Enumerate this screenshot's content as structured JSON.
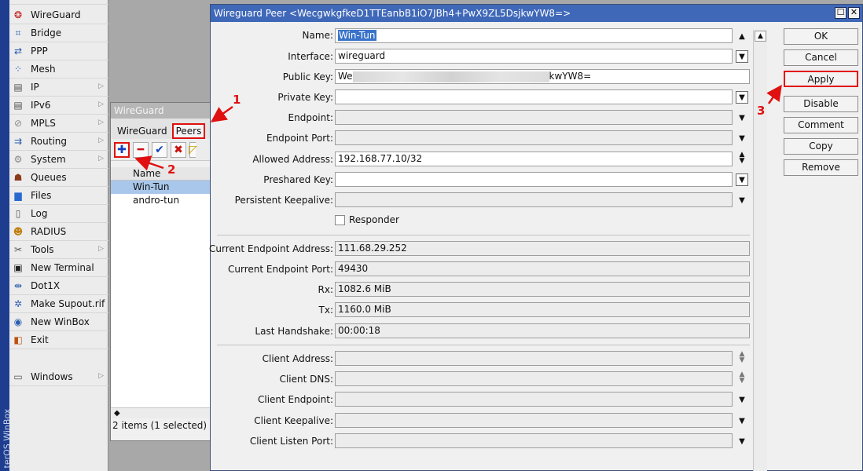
{
  "side_strip": {
    "text": "terOS WinBox"
  },
  "menu": {
    "items": [
      {
        "label": "WireGuard",
        "icon": "wireguard-icon",
        "arrow": false
      },
      {
        "label": "Bridge",
        "icon": "bridge-icon",
        "arrow": false
      },
      {
        "label": "PPP",
        "icon": "ppp-icon",
        "arrow": false
      },
      {
        "label": "Mesh",
        "icon": "mesh-icon",
        "arrow": false
      },
      {
        "label": "IP",
        "icon": "ip-icon",
        "arrow": true
      },
      {
        "label": "IPv6",
        "icon": "ipv6-icon",
        "arrow": true
      },
      {
        "label": "MPLS",
        "icon": "mpls-icon",
        "arrow": true
      },
      {
        "label": "Routing",
        "icon": "routing-icon",
        "arrow": true
      },
      {
        "label": "System",
        "icon": "system-icon",
        "arrow": true
      },
      {
        "label": "Queues",
        "icon": "queues-icon",
        "arrow": false
      },
      {
        "label": "Files",
        "icon": "files-icon",
        "arrow": false
      },
      {
        "label": "Log",
        "icon": "log-icon",
        "arrow": false
      },
      {
        "label": "RADIUS",
        "icon": "radius-icon",
        "arrow": false
      },
      {
        "label": "Tools",
        "icon": "tools-icon",
        "arrow": true
      },
      {
        "label": "New Terminal",
        "icon": "terminal-icon",
        "arrow": false
      },
      {
        "label": "Dot1X",
        "icon": "dot1x-icon",
        "arrow": false
      },
      {
        "label": "Make Supout.rif",
        "icon": "supout-icon",
        "arrow": false
      },
      {
        "label": "New WinBox",
        "icon": "winbox-icon",
        "arrow": false
      },
      {
        "label": "Exit",
        "icon": "exit-icon",
        "arrow": false
      },
      {
        "label": "Windows",
        "icon": "windows-icon",
        "arrow": true
      }
    ]
  },
  "wg_window": {
    "title": "WireGuard",
    "tabs": [
      "WireGuard",
      "Peers"
    ],
    "list_header": "Name",
    "rows": [
      {
        "name": "Win-Tun",
        "selected": true
      },
      {
        "name": "andro-tun",
        "selected": false
      }
    ],
    "status": "2 items (1 selected)"
  },
  "peer_dialog": {
    "title": "Wireguard Peer <WecgwkgfkeD1TTEanbB1iO7JBh4+PwX9ZL5DsjkwYW8=>",
    "fields": {
      "name": {
        "label": "Name:",
        "value": "Win-Tun"
      },
      "interface": {
        "label": "Interface:",
        "value": "wireguard"
      },
      "public_key": {
        "label": "Public Key:",
        "value_start": "We",
        "value_end": "kwYW8="
      },
      "private_key": {
        "label": "Private Key:",
        "value": ""
      },
      "endpoint": {
        "label": "Endpoint:",
        "value": ""
      },
      "endpoint_port": {
        "label": "Endpoint Port:",
        "value": ""
      },
      "allowed_address": {
        "label": "Allowed Address:",
        "value": "192.168.77.10/32"
      },
      "preshared_key": {
        "label": "Preshared Key:",
        "value": ""
      },
      "persistent_keepalive": {
        "label": "Persistent Keepalive:",
        "value": ""
      },
      "responder": {
        "label": "Responder",
        "checked": false
      },
      "current_endpoint_address": {
        "label": "Current Endpoint Address:",
        "value": "111.68.29.252"
      },
      "current_endpoint_port": {
        "label": "Current Endpoint Port:",
        "value": "49430"
      },
      "rx": {
        "label": "Rx:",
        "value": "1082.6 MiB"
      },
      "tx": {
        "label": "Tx:",
        "value": "1160.0 MiB"
      },
      "last_handshake": {
        "label": "Last Handshake:",
        "value": "00:00:18"
      },
      "client_address": {
        "label": "Client Address:",
        "value": ""
      },
      "client_dns": {
        "label": "Client DNS:",
        "value": ""
      },
      "client_endpoint": {
        "label": "Client Endpoint:",
        "value": ""
      },
      "client_keepalive": {
        "label": "Client Keepalive:",
        "value": ""
      },
      "client_listen_port": {
        "label": "Client Listen Port:",
        "value": ""
      }
    },
    "buttons": [
      "OK",
      "Cancel",
      "Apply",
      "Disable",
      "Comment",
      "Copy",
      "Remove"
    ]
  },
  "annotations": {
    "n1": "1",
    "n2": "2",
    "n3": "3"
  },
  "colors": {
    "accent_red": "#e01010",
    "title_blue": "#3f68b8",
    "selection": "#a9c7ea"
  }
}
